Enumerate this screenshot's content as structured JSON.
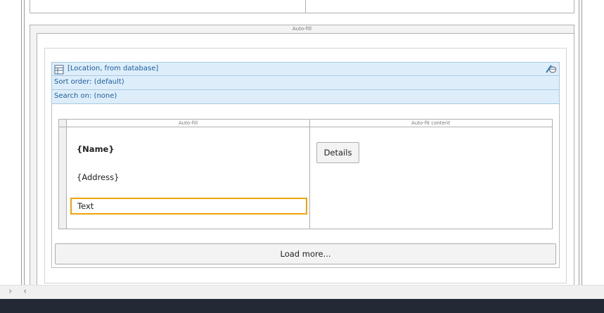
{
  "outer_panel": {
    "title": "Auto-fill"
  },
  "database_section": {
    "source": "[Location, from database]",
    "sort_order": "Sort order: (default)",
    "search_on": "Search on: (none)"
  },
  "inner_table": {
    "col1_title": "Auto-fill",
    "col2_title": "Auto-fit content",
    "name_field": "{Name}",
    "address_field": "{Address}",
    "text_field": "Text",
    "details_button": "Details"
  },
  "load_more_button": "Load more...",
  "scrollbar": {
    "right_chevron": "›",
    "left_chevron": "‹"
  },
  "colors": {
    "selection_border": "#f0a30a",
    "band_background": "#ddeefa",
    "band_text": "#1b5c9b",
    "status_bar": "#232a36"
  },
  "icons": [
    "database-table-icon",
    "edit-data-source-icon",
    "chevron-right-icon",
    "chevron-left-icon"
  ]
}
